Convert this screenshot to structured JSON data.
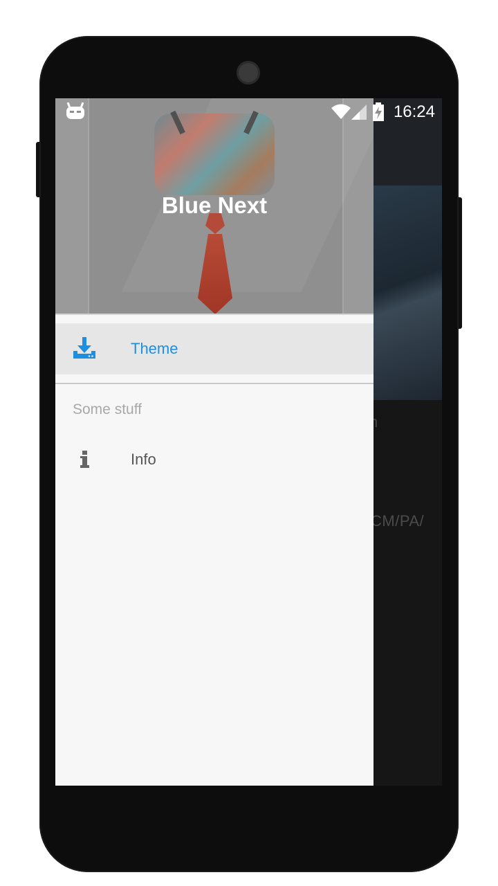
{
  "status_bar": {
    "time": "16:24",
    "icons": [
      "cyanogen-icon",
      "wifi-icon",
      "signal-icon",
      "battery-charging-icon"
    ]
  },
  "drawer": {
    "header_title": "Blue Next",
    "primary_item": {
      "label": "Theme",
      "icon": "download-icon",
      "selected": true
    },
    "section_title": "Some stuff",
    "items": [
      {
        "label": "Info",
        "icon": "info-icon"
      }
    ]
  },
  "background_content": {
    "line1": "n",
    "line2": "CM/PA/"
  },
  "colors": {
    "accent": "#1e8fe0",
    "drawer_bg": "#f7f7f7",
    "selected_bg": "#e6e6e6"
  }
}
